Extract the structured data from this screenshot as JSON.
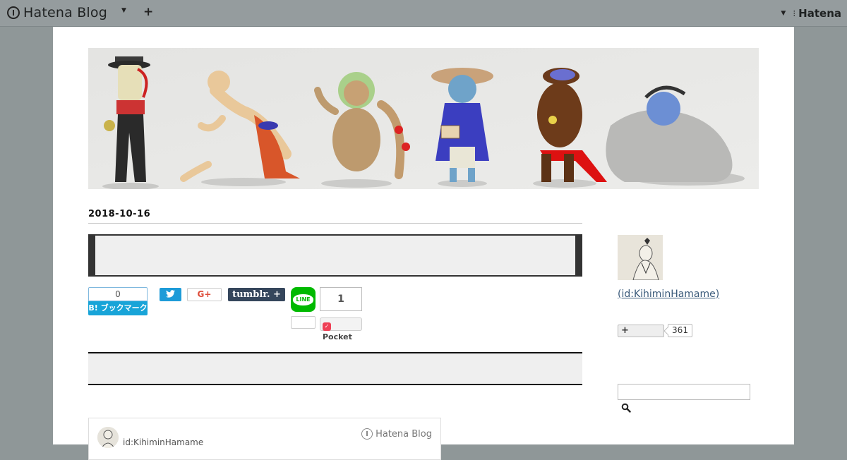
{
  "topbar": {
    "brand": "Hatena Blog",
    "add_label": "+",
    "hatena_label": "Hatena"
  },
  "article": {
    "date": "2018-10-16",
    "title": ""
  },
  "share": {
    "hatebu_count": "0",
    "hatebu_label": "B! ブックマーク",
    "twitter_label": "",
    "gplus_label": "G+",
    "tumblr_label": "tumblr. +",
    "line_label": "LINE",
    "pocket_count": "1",
    "pocket_label": "Pocket"
  },
  "author_card": {
    "id": "id:KihiminHamame",
    "service": "Hatena Blog"
  },
  "sidebar": {
    "profile_id": "(id:KihiminHamame)",
    "follow_label": "+",
    "follow_count": "361",
    "search_placeholder": ""
  },
  "colors": {
    "topbar_bg": "#959c9e",
    "page_bg": "#8f9798",
    "hatebu": "#18a4d8",
    "twitter": "#1d9bd8",
    "tumblr": "#35465c",
    "line": "#00b900",
    "pocket": "#ef4056",
    "link": "#3a5a7a"
  },
  "icons": {
    "brand": "hatena-blog-logo-icon",
    "search": "search-icon",
    "twitter": "twitter-bird-icon",
    "pocket": "pocket-icon"
  }
}
